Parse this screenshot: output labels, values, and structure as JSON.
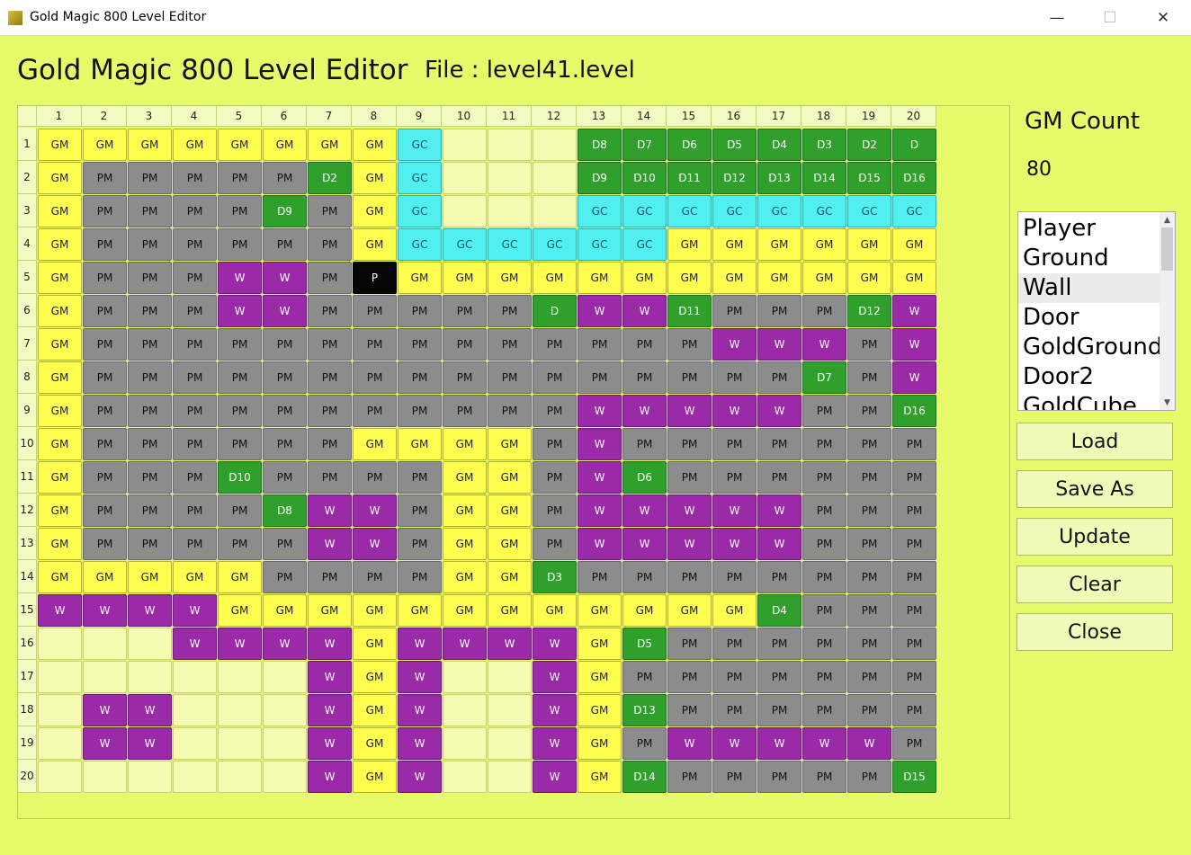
{
  "window": {
    "title": "Gold Magic 800 Level Editor",
    "min": "—",
    "max": "☐",
    "close": "✕"
  },
  "header": {
    "title": "Gold Magic 800 Level Editor",
    "file": "File : level41.level"
  },
  "grid": {
    "columns": [
      "1",
      "2",
      "3",
      "4",
      "5",
      "6",
      "7",
      "8",
      "9",
      "10",
      "11",
      "12",
      "13",
      "14",
      "15",
      "16",
      "17",
      "18",
      "19",
      "20"
    ],
    "row_labels": [
      "1",
      "2",
      "3",
      "4",
      "5",
      "6",
      "7",
      "8",
      "9",
      "10",
      "11",
      "12",
      "13",
      "14",
      "15",
      "16",
      "17",
      "18",
      "19",
      "20"
    ],
    "rows": [
      [
        "GM",
        "GM",
        "GM",
        "GM",
        "GM",
        "GM",
        "GM",
        "GM",
        "GC",
        "",
        "",
        "",
        "D8",
        "D7",
        "D6",
        "D5",
        "D4",
        "D3",
        "D2",
        "D"
      ],
      [
        "GM",
        "PM",
        "PM",
        "PM",
        "PM",
        "PM",
        "D2",
        "GM",
        "GC",
        "",
        "",
        "",
        "D9",
        "D10",
        "D11",
        "D12",
        "D13",
        "D14",
        "D15",
        "D16"
      ],
      [
        "GM",
        "PM",
        "PM",
        "PM",
        "PM",
        "D9",
        "PM",
        "GM",
        "GC",
        "",
        "",
        "",
        "GC",
        "GC",
        "GC",
        "GC",
        "GC",
        "GC",
        "GC",
        "GC"
      ],
      [
        "GM",
        "PM",
        "PM",
        "PM",
        "PM",
        "PM",
        "PM",
        "GM",
        "GC",
        "GC",
        "GC",
        "GC",
        "GC",
        "GC",
        "GM",
        "GM",
        "GM",
        "GM",
        "GM",
        "GM"
      ],
      [
        "GM",
        "PM",
        "PM",
        "PM",
        "W",
        "W",
        "PM",
        "P",
        "GM",
        "GM",
        "GM",
        "GM",
        "GM",
        "GM",
        "GM",
        "GM",
        "GM",
        "GM",
        "GM",
        "GM"
      ],
      [
        "GM",
        "PM",
        "PM",
        "PM",
        "W",
        "W",
        "PM",
        "PM",
        "PM",
        "PM",
        "PM",
        "D",
        "W",
        "W",
        "D11",
        "PM",
        "PM",
        "PM",
        "D12",
        "W"
      ],
      [
        "GM",
        "PM",
        "PM",
        "PM",
        "PM",
        "PM",
        "PM",
        "PM",
        "PM",
        "PM",
        "PM",
        "PM",
        "PM",
        "PM",
        "PM",
        "W",
        "W",
        "W",
        "PM",
        "W"
      ],
      [
        "GM",
        "PM",
        "PM",
        "PM",
        "PM",
        "PM",
        "PM",
        "PM",
        "PM",
        "PM",
        "PM",
        "PM",
        "PM",
        "PM",
        "PM",
        "PM",
        "PM",
        "D7",
        "PM",
        "W"
      ],
      [
        "GM",
        "PM",
        "PM",
        "PM",
        "PM",
        "PM",
        "PM",
        "PM",
        "PM",
        "PM",
        "PM",
        "PM",
        "W",
        "W",
        "W",
        "W",
        "W",
        "PM",
        "PM",
        "D16"
      ],
      [
        "GM",
        "PM",
        "PM",
        "PM",
        "PM",
        "PM",
        "PM",
        "GM",
        "GM",
        "GM",
        "GM",
        "PM",
        "W",
        "PM",
        "PM",
        "PM",
        "PM",
        "PM",
        "PM",
        "PM"
      ],
      [
        "GM",
        "PM",
        "PM",
        "PM",
        "D10",
        "PM",
        "PM",
        "PM",
        "PM",
        "GM",
        "GM",
        "PM",
        "W",
        "D6",
        "PM",
        "PM",
        "PM",
        "PM",
        "PM",
        "PM"
      ],
      [
        "GM",
        "PM",
        "PM",
        "PM",
        "PM",
        "D8",
        "W",
        "W",
        "PM",
        "GM",
        "GM",
        "PM",
        "W",
        "W",
        "W",
        "W",
        "W",
        "PM",
        "PM",
        "PM"
      ],
      [
        "GM",
        "PM",
        "PM",
        "PM",
        "PM",
        "PM",
        "W",
        "W",
        "PM",
        "GM",
        "GM",
        "PM",
        "W",
        "W",
        "W",
        "W",
        "W",
        "PM",
        "PM",
        "PM"
      ],
      [
        "GM",
        "GM",
        "GM",
        "GM",
        "GM",
        "PM",
        "PM",
        "PM",
        "PM",
        "GM",
        "GM",
        "D3",
        "PM",
        "PM",
        "PM",
        "PM",
        "PM",
        "PM",
        "PM",
        "PM"
      ],
      [
        "W",
        "W",
        "W",
        "W",
        "GM",
        "GM",
        "GM",
        "GM",
        "GM",
        "GM",
        "GM",
        "GM",
        "GM",
        "GM",
        "GM",
        "GM",
        "D4",
        "PM",
        "PM",
        "PM"
      ],
      [
        "",
        "",
        "",
        "W",
        "W",
        "W",
        "W",
        "GM",
        "W",
        "W",
        "W",
        "W",
        "GM",
        "D5",
        "PM",
        "PM",
        "PM",
        "PM",
        "PM",
        "PM"
      ],
      [
        "",
        "",
        "",
        "",
        "",
        "",
        "W",
        "GM",
        "W",
        "",
        "",
        "W",
        "GM",
        "PM",
        "PM",
        "PM",
        "PM",
        "PM",
        "PM",
        "PM"
      ],
      [
        "",
        "W",
        "W",
        "",
        "",
        "",
        "W",
        "GM",
        "W",
        "",
        "",
        "W",
        "GM",
        "D13",
        "PM",
        "PM",
        "PM",
        "PM",
        "PM",
        "PM"
      ],
      [
        "",
        "W",
        "W",
        "",
        "",
        "",
        "W",
        "GM",
        "W",
        "",
        "",
        "W",
        "GM",
        "PM",
        "W",
        "W",
        "W",
        "W",
        "W",
        "PM"
      ],
      [
        "",
        "",
        "",
        "",
        "",
        "",
        "W",
        "GM",
        "W",
        "",
        "",
        "W",
        "GM",
        "D14",
        "PM",
        "PM",
        "PM",
        "PM",
        "PM",
        "D15"
      ]
    ]
  },
  "sidebar": {
    "gm_count_label": "GM Count",
    "gm_count_value": "80",
    "tiles": [
      "Player",
      "Ground",
      "Wall",
      "Door",
      "GoldGround",
      "Door2",
      "GoldCube"
    ],
    "selected_tile": "Wall",
    "buttons": {
      "load": "Load",
      "save_as": "Save As",
      "update": "Update",
      "clear": "Clear",
      "close": "Close"
    }
  },
  "colors": {
    "background": "#e6fa6a",
    "gold_ground": "#ffff50",
    "pm": "#8c8c8c",
    "wall": "#9a2aa8",
    "gold_cube": "#50f0f0",
    "door": "#30a02c",
    "player": "#050505",
    "empty": "#f5fbb0"
  }
}
